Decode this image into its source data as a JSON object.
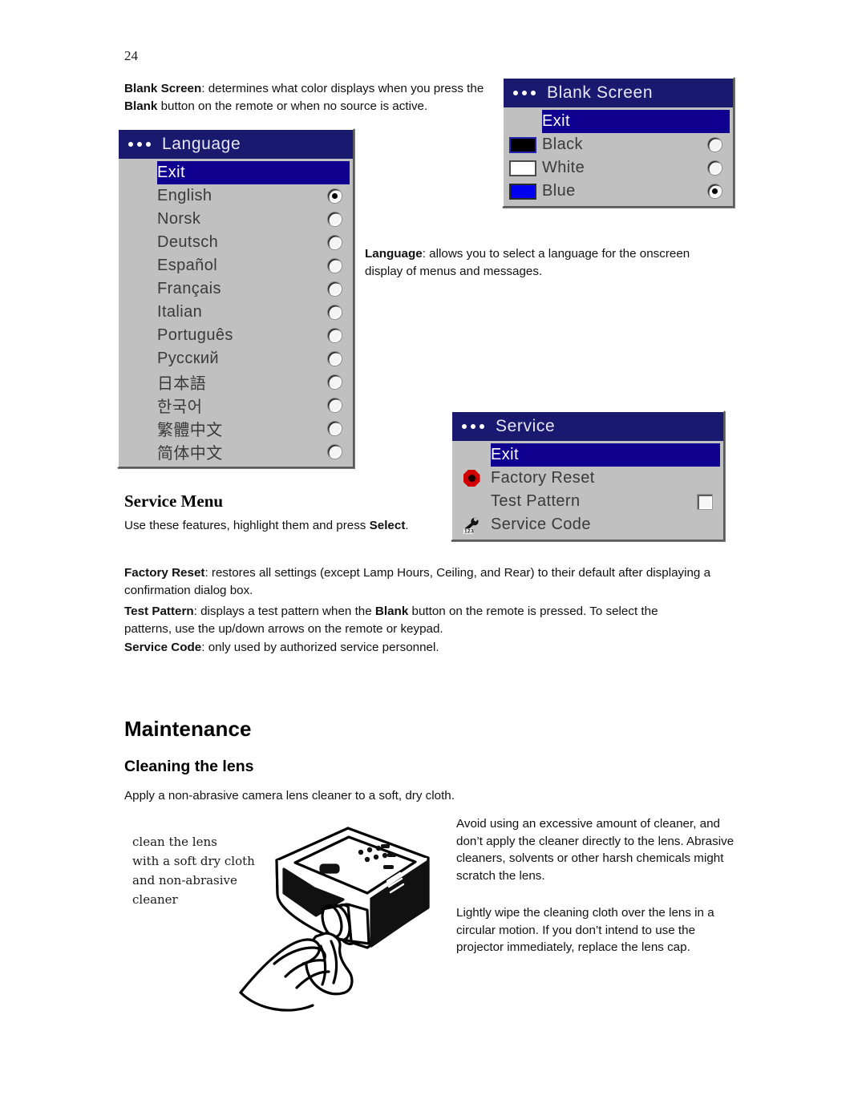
{
  "page": {
    "number": "24"
  },
  "intro": {
    "blank_screen_term": "Blank Screen",
    "blank_screen_rest": ": determines what color displays when you press the ",
    "blank_term": "Blank",
    "blank_screen_tail": " button on the remote or when no source is active."
  },
  "language_desc": {
    "term": "Language",
    "rest": ": allows you to select a language for the onscreen display of menus and messages."
  },
  "blank_screen_menu": {
    "title": "Blank Screen",
    "exit": "Exit",
    "items": [
      {
        "label": "Black",
        "swatch": "black",
        "selected": false
      },
      {
        "label": "White",
        "swatch": "white",
        "selected": false
      },
      {
        "label": "Blue",
        "swatch": "blue",
        "selected": true
      }
    ]
  },
  "language_menu": {
    "title": "Language",
    "exit": "Exit",
    "items": [
      {
        "label": "English",
        "selected": true
      },
      {
        "label": "Norsk",
        "selected": false
      },
      {
        "label": "Deutsch",
        "selected": false
      },
      {
        "label": "Español",
        "selected": false
      },
      {
        "label": "Français",
        "selected": false
      },
      {
        "label": "Italian",
        "selected": false
      },
      {
        "label": "Português",
        "selected": false
      },
      {
        "label": "Русский",
        "selected": false
      },
      {
        "label": "日本語",
        "selected": false
      },
      {
        "label": "한국어",
        "selected": false
      },
      {
        "label": "繁體中文",
        "selected": false
      },
      {
        "label": "简体中文",
        "selected": false
      }
    ]
  },
  "service_menu": {
    "title": "Service",
    "exit": "Exit",
    "items": [
      {
        "label": "Factory Reset",
        "icon": "stop-sign-icon",
        "control": "none"
      },
      {
        "label": "Test Pattern",
        "icon": "none",
        "control": "checkbox",
        "checked": false
      },
      {
        "label": "Service Code",
        "icon": "wrench-123-icon",
        "control": "none"
      }
    ]
  },
  "service_section": {
    "heading": "Service Menu",
    "intro_a": "Use these features, highlight them and press ",
    "intro_b": "Select",
    "intro_c": ".",
    "paragraphs": [
      {
        "term": "Factory Reset",
        "text": ": restores all settings (except Lamp Hours, Ceiling, and Rear) to their default after displaying a confirmation dialog box."
      },
      {
        "term": "Test Pattern",
        "text_a": ": displays a test pattern when the ",
        "term_b": "Blank",
        "text_b": " button on the remote is pressed. To select the patterns, use the up/down arrows on the remote or keypad."
      },
      {
        "term": "Service Code",
        "text": ": only used by authorized service personnel."
      }
    ]
  },
  "maintenance": {
    "heading": "Maintenance",
    "subheading": "Cleaning the lens",
    "intro": "Apply a non-abrasive camera lens cleaner to a soft, dry cloth.",
    "caption": "clean the lens\nwith a soft dry cloth\nand non-abrasive\ncleaner",
    "notes": [
      "Avoid using an excessive amount of cleaner, and don’t apply the cleaner directly to the lens. Abrasive cleaners, solvents or other harsh chemicals might scratch the lens.",
      "Lightly wipe the cleaning cloth over the lens in a circular motion. If you don’t intend to use the projector immediately, replace the lens cap."
    ]
  },
  "colors": {
    "menu_title_blue": "#191970",
    "menu_highlight_blue": "#100090",
    "menu_face_gray": "#c0c0c0",
    "swatch_blue": "#0000ee",
    "stop_icon_red": "#d00000"
  }
}
